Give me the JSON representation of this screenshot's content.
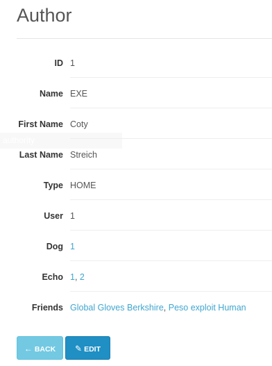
{
  "header": {
    "title": "Author"
  },
  "ghost_label": "authority",
  "fields": {
    "id": {
      "label": "ID",
      "value": "1"
    },
    "name": {
      "label": "Name",
      "value": "EXE"
    },
    "first_name": {
      "label": "First Name",
      "value": "Coty"
    },
    "last_name": {
      "label": "Last Name",
      "value": "Streich"
    },
    "type": {
      "label": "Type",
      "value": "HOME"
    },
    "user": {
      "label": "User",
      "value": "1"
    },
    "dog": {
      "label": "Dog",
      "value": "1"
    },
    "echo": {
      "label": "Echo",
      "links": [
        "1",
        "2"
      ],
      "separator": ", "
    },
    "friends": {
      "label": "Friends",
      "links": [
        "Global Gloves Berkshire",
        "Peso exploit Human"
      ],
      "separator": ", "
    }
  },
  "buttons": {
    "back": {
      "label": "BACK",
      "icon": "arrow-left-icon"
    },
    "edit": {
      "label": "EDIT",
      "icon": "pencil-icon"
    }
  },
  "colors": {
    "link": "#3fa6cf",
    "back_button": "#5bc0de",
    "edit_button": "#1f8fc4"
  }
}
